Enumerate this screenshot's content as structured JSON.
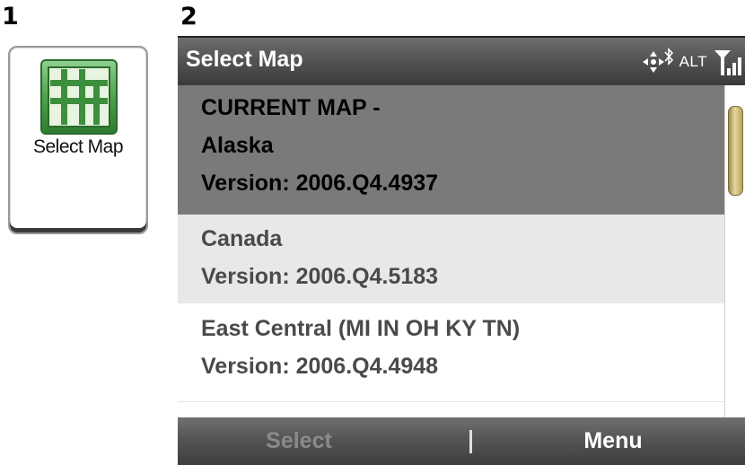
{
  "labels": {
    "step1": "1",
    "step2": "2"
  },
  "tile": {
    "label": "Select Map",
    "icon": "map-grid-icon",
    "accent": "#4fa24f"
  },
  "titlebar": {
    "title": "Select Map",
    "alt": "ALT",
    "icons": [
      "navigation-arrows-icon",
      "bluetooth-icon",
      "signal-strength-icon"
    ]
  },
  "maps": [
    {
      "lines": [
        "CURRENT MAP -",
        "Alaska",
        "Version:  2006.Q4.4937"
      ],
      "selected": true
    },
    {
      "lines": [
        "Canada",
        "Version:  2006.Q4.5183"
      ],
      "selected": false
    },
    {
      "lines": [
        "East Central  (MI IN OH KY TN)",
        "Version:  2006.Q4.4948"
      ],
      "selected": false
    }
  ],
  "softkeys": {
    "left": "Select",
    "right": "Menu"
  },
  "colors": {
    "selected_row": "#7a7a78",
    "row_alt": "#e8e8e8",
    "titlebar": "#575757",
    "scroll_thumb": "#d4c47a"
  }
}
